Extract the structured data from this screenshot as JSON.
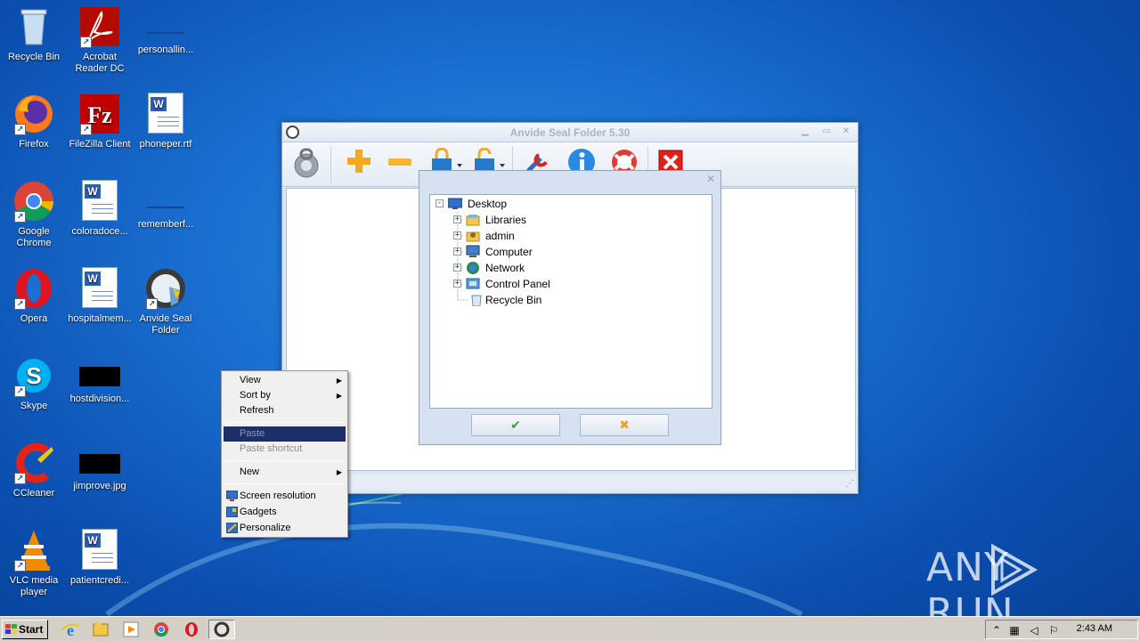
{
  "desktop": {
    "icons": [
      {
        "label": "Recycle Bin",
        "icon": "recycle-bin-icon"
      },
      {
        "label": "Acrobat Reader DC",
        "icon": "acrobat-icon"
      },
      {
        "label": "personallin...",
        "icon": "blank-file-icon"
      },
      {
        "label": "Firefox",
        "icon": "firefox-icon"
      },
      {
        "label": "FileZilla Client",
        "icon": "filezilla-icon"
      },
      {
        "label": "phoneper.rtf",
        "icon": "word-doc-icon"
      },
      {
        "label": "Google Chrome",
        "icon": "chrome-icon"
      },
      {
        "label": "coloradoce...",
        "icon": "word-doc-icon"
      },
      {
        "label": "rememberf...",
        "icon": "blank-file-icon"
      },
      {
        "label": "Opera",
        "icon": "opera-icon"
      },
      {
        "label": "hospitalmem...",
        "icon": "word-doc-icon"
      },
      {
        "label": "Anvide Seal Folder",
        "icon": "anvide-seal-icon"
      },
      {
        "label": "Skype",
        "icon": "skype-icon"
      },
      {
        "label": "hostdivision...",
        "icon": "image-thumb-icon"
      },
      {
        "label": "CCleaner",
        "icon": "ccleaner-icon"
      },
      {
        "label": "jimprove.jpg",
        "icon": "image-thumb-icon"
      },
      {
        "label": "VLC media player",
        "icon": "vlc-icon"
      },
      {
        "label": "patientcredi...",
        "icon": "word-doc-icon"
      }
    ]
  },
  "app": {
    "title": "Anvide Seal Folder 5.30",
    "toolbar": [
      "lock-main-icon",
      "add-folder-icon",
      "remove-folder-icon",
      "close-access-icon",
      "open-access-icon",
      "settings-icon",
      "info-icon",
      "help-icon",
      "exit-icon"
    ]
  },
  "dialog": {
    "tree": [
      {
        "label": "Desktop",
        "expander": "-",
        "icon": "desktop-icon"
      },
      {
        "label": "Libraries",
        "expander": "+",
        "icon": "libraries-icon"
      },
      {
        "label": "admin",
        "expander": "+",
        "icon": "user-folder-icon"
      },
      {
        "label": "Computer",
        "expander": "+",
        "icon": "computer-icon"
      },
      {
        "label": "Network",
        "expander": "+",
        "icon": "network-icon"
      },
      {
        "label": "Control Panel",
        "expander": "+",
        "icon": "control-panel-icon"
      },
      {
        "label": "Recycle Bin",
        "expander": "",
        "icon": "recycle-bin-icon"
      }
    ],
    "ok_glyph": "✔",
    "cancel_glyph": "✖"
  },
  "context_menu": {
    "items": [
      {
        "label": "View",
        "submenu": true
      },
      {
        "label": "Sort by",
        "submenu": true
      },
      {
        "label": "Refresh",
        "submenu": false
      },
      {
        "label": "Paste",
        "disabled": true,
        "highlighted": true
      },
      {
        "label": "Paste shortcut",
        "disabled": true
      },
      {
        "label": "New",
        "submenu": true
      },
      {
        "label": "Screen resolution",
        "icon": "screen-resolution-icon"
      },
      {
        "label": "Gadgets",
        "icon": "gadgets-icon"
      },
      {
        "label": "Personalize",
        "icon": "personalize-icon"
      }
    ]
  },
  "taskbar": {
    "start_label": "Start",
    "clock": "2:43 AM",
    "tasks": [
      "ie-icon",
      "explorer-icon",
      "media-player-icon",
      "chrome-icon",
      "opera-icon",
      "anvide-task-icon"
    ]
  },
  "watermark": {
    "left": "ANY",
    "right": "RUN"
  }
}
